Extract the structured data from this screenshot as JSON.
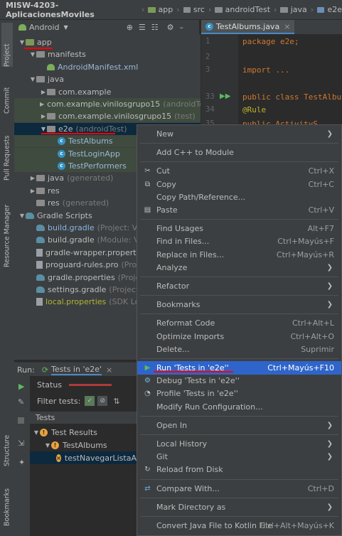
{
  "breadcrumb": [
    "MISW-4203-AplicacionesMoviles",
    "app",
    "src",
    "androidTest",
    "java",
    "e2e"
  ],
  "left_strip": {
    "tabs": [
      "Project",
      "Commit",
      "Pull Requests",
      "Resource Manager",
      "Structure",
      "Bookmarks"
    ]
  },
  "project_toolbar": {
    "view": "Android"
  },
  "tree": [
    {
      "label": "app",
      "indent": 0,
      "arrow": "down",
      "icon": "folder-green"
    },
    {
      "label": "manifests",
      "indent": 1,
      "arrow": "down",
      "icon": "folder"
    },
    {
      "label": "AndroidManifest.xml",
      "indent": 2,
      "arrow": "",
      "icon": "android"
    },
    {
      "label": "java",
      "indent": 1,
      "arrow": "down",
      "icon": "folder"
    },
    {
      "label": "com.example",
      "indent": 2,
      "arrow": "right",
      "icon": "folder"
    },
    {
      "label": "com.example.vinilosgrupo15",
      "suffix": "(androidTest)",
      "indent": 2,
      "arrow": "right",
      "icon": "folder"
    },
    {
      "label": "com.example.vinilosgrupo15",
      "suffix": "(test)",
      "indent": 2,
      "arrow": "right",
      "icon": "folder"
    },
    {
      "label": "e2e",
      "suffix": "(androidTest)",
      "indent": 2,
      "arrow": "down",
      "icon": "folder",
      "selected": true
    },
    {
      "label": "TestAlbums",
      "indent": 3,
      "arrow": "",
      "icon": "class"
    },
    {
      "label": "TestLoginApp",
      "indent": 3,
      "arrow": "",
      "icon": "class"
    },
    {
      "label": "TestPerformers",
      "indent": 3,
      "arrow": "",
      "icon": "class"
    },
    {
      "label": "java",
      "suffix": "(generated)",
      "indent": 1,
      "arrow": "right",
      "icon": "folder"
    },
    {
      "label": "res",
      "indent": 1,
      "arrow": "right",
      "icon": "folder"
    },
    {
      "label": "res",
      "suffix": "(generated)",
      "indent": 1,
      "arrow": "",
      "icon": "folder"
    },
    {
      "label": "Gradle Scripts",
      "indent": 0,
      "arrow": "down",
      "icon": "gradle"
    },
    {
      "label": "build.gradle",
      "suffix": "(Project: Vinil",
      "indent": 1,
      "arrow": "",
      "icon": "gradle",
      "color": "#8ab6e0"
    },
    {
      "label": "build.gradle",
      "suffix": "(Module: Vini",
      "indent": 1,
      "arrow": "",
      "icon": "gradle"
    },
    {
      "label": "gradle-wrapper.properties",
      "indent": 1,
      "arrow": "",
      "icon": "file"
    },
    {
      "label": "proguard-rules.pro",
      "suffix": "(ProGu",
      "indent": 1,
      "arrow": "",
      "icon": "file"
    },
    {
      "label": "gradle.properties",
      "suffix": "(Project I",
      "indent": 1,
      "arrow": "",
      "icon": "gradle"
    },
    {
      "label": "settings.gradle",
      "suffix": "(Project Se",
      "indent": 1,
      "arrow": "",
      "icon": "gradle"
    },
    {
      "label": "local.properties",
      "suffix": "(SDK Locat",
      "indent": 1,
      "arrow": "",
      "icon": "file",
      "color": "#b5b234"
    }
  ],
  "editor": {
    "tab": "TestAlbums.java",
    "line_numbers": [
      "1",
      "2",
      "3",
      "33",
      "34",
      "35"
    ],
    "lines": [
      "package e2e;",
      "",
      "import ...",
      "public class TestAlbu",
      "    @Rule",
      "    public ActivityS"
    ]
  },
  "context_menu": {
    "items": [
      {
        "label": "New",
        "sub": true
      },
      {
        "sep": true
      },
      {
        "label": "Add C++ to Module"
      },
      {
        "sep": true
      },
      {
        "label": "Cut",
        "shortcut": "Ctrl+X",
        "icon": "cut"
      },
      {
        "label": "Copy",
        "shortcut": "Ctrl+C",
        "icon": "copy"
      },
      {
        "label": "Copy Path/Reference..."
      },
      {
        "label": "Paste",
        "shortcut": "Ctrl+V",
        "icon": "paste"
      },
      {
        "sep": true
      },
      {
        "label": "Find Usages",
        "shortcut": "Alt+F7"
      },
      {
        "label": "Find in Files...",
        "shortcut": "Ctrl+Mayús+F"
      },
      {
        "label": "Replace in Files...",
        "shortcut": "Ctrl+Mayús+R"
      },
      {
        "label": "Analyze",
        "sub": true
      },
      {
        "sep": true
      },
      {
        "label": "Refactor",
        "sub": true
      },
      {
        "sep": true
      },
      {
        "label": "Bookmarks",
        "sub": true
      },
      {
        "sep": true
      },
      {
        "label": "Reformat Code",
        "shortcut": "Ctrl+Alt+L"
      },
      {
        "label": "Optimize Imports",
        "shortcut": "Ctrl+Alt+O"
      },
      {
        "label": "Delete...",
        "shortcut": "Suprimir"
      },
      {
        "sep": true
      },
      {
        "label": "Run 'Tests in 'e2e''",
        "shortcut": "Ctrl+Mayús+F10",
        "icon": "run",
        "active": true
      },
      {
        "label": "Debug 'Tests in 'e2e''",
        "icon": "debug"
      },
      {
        "label": "Profile 'Tests in 'e2e''",
        "icon": "profile"
      },
      {
        "label": "Modify Run Configuration..."
      },
      {
        "sep": true
      },
      {
        "label": "Open In",
        "sub": true
      },
      {
        "sep": true
      },
      {
        "label": "Local History",
        "sub": true
      },
      {
        "label": "Git",
        "sub": true
      },
      {
        "label": "Reload from Disk",
        "icon": "reload"
      },
      {
        "sep": true
      },
      {
        "label": "Compare With...",
        "shortcut": "Ctrl+D",
        "icon": "compare"
      },
      {
        "sep": true
      },
      {
        "label": "Mark Directory as",
        "sub": true
      },
      {
        "sep": true
      },
      {
        "label": "Convert Java File to Kotlin File",
        "shortcut": "Ctrl+Alt+Mayús+K"
      }
    ]
  },
  "run_panel": {
    "label": "Run:",
    "tab": "Tests in 'e2e'",
    "status_label": "Status",
    "filter_label": "Filter tests:",
    "tests_header": "Tests",
    "tree": [
      {
        "label": "Test Results",
        "indent": 0
      },
      {
        "label": "TestAlbums",
        "indent": 1
      },
      {
        "label": "testNavegarListaA",
        "indent": 2,
        "selected": true
      }
    ]
  }
}
